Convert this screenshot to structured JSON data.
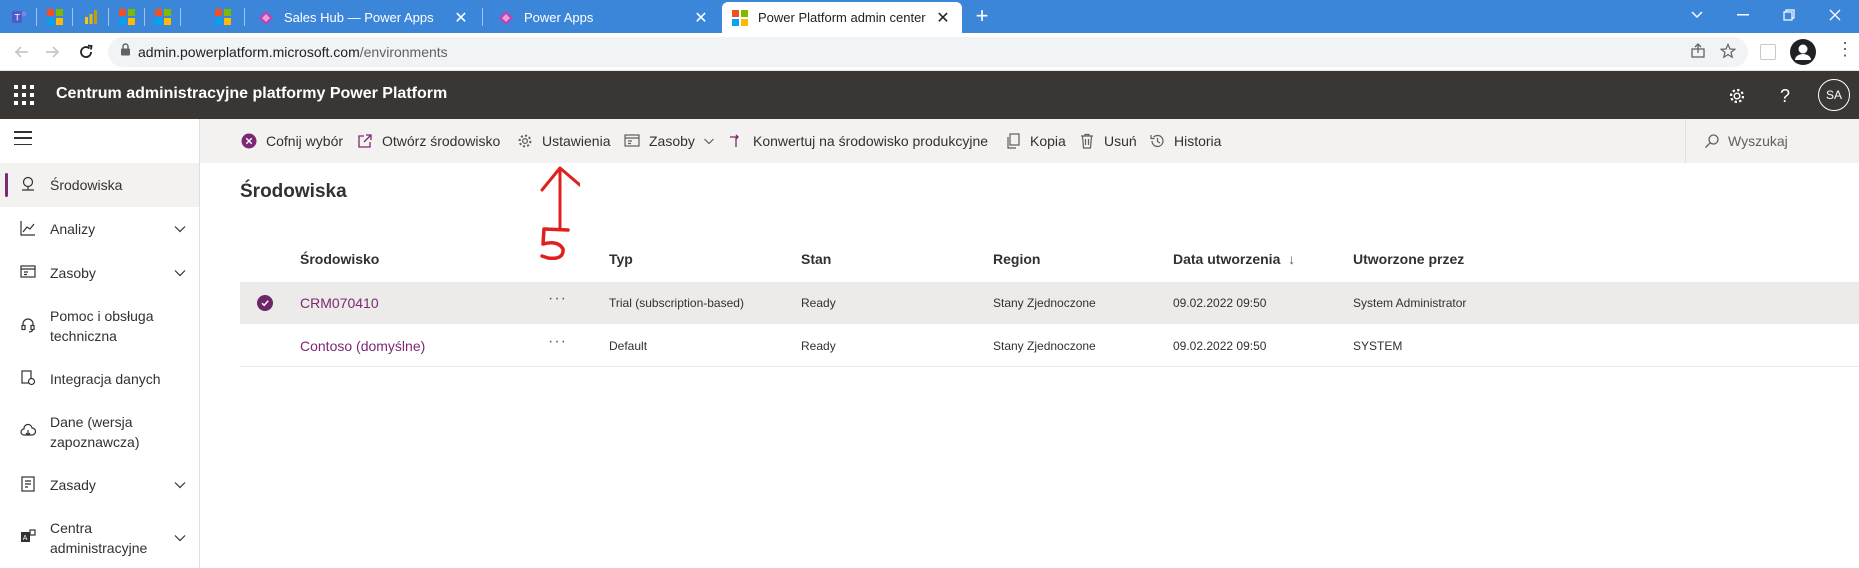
{
  "browser": {
    "tabs": [
      {
        "title": "Sales Hub — Power Apps"
      },
      {
        "title": "Power Apps"
      },
      {
        "title": "Power Platform admin center",
        "active": true
      }
    ],
    "new_tab_symbol": "+",
    "url_host": "admin.powerplatform.microsoft.com",
    "url_path": "/environments"
  },
  "header": {
    "title": "Centrum administracyjne platformy Power Platform",
    "avatar_initials": "SA"
  },
  "sidebar": {
    "items": [
      {
        "label": "Środowiska",
        "icon": "globe-network-icon",
        "active": true,
        "expandable": false
      },
      {
        "label": "Analizy",
        "icon": "chart-icon",
        "expandable": true
      },
      {
        "label": "Zasoby",
        "icon": "resources-icon",
        "expandable": true
      },
      {
        "label": "Pomoc i obsługa techniczna",
        "icon": "headset-icon",
        "expandable": false
      },
      {
        "label": "Integracja danych",
        "icon": "data-integration-icon",
        "expandable": false
      },
      {
        "label": "Dane (wersja zapoznawcza)",
        "icon": "cloud-data-icon",
        "expandable": false
      },
      {
        "label": "Zasady",
        "icon": "policy-icon",
        "expandable": true
      },
      {
        "label": "Centra administracyjne",
        "icon": "admin-centers-icon",
        "expandable": true
      }
    ]
  },
  "commandbar": {
    "deselect": "Cofnij wybór",
    "open": "Otwórz środowisko",
    "settings": "Ustawienia",
    "resources": "Zasoby",
    "convert": "Konwertuj na środowisko produkcyjne",
    "copy": "Kopia",
    "delete": "Usuń",
    "history": "Historia",
    "search": "Wyszukaj"
  },
  "main": {
    "title": "Środowiska",
    "columns": {
      "env": "Środowisko",
      "type": "Typ",
      "state": "Stan",
      "region": "Region",
      "created": "Data utworzenia",
      "sort_arrow": "↓",
      "created_by": "Utworzone przez"
    },
    "rows": [
      {
        "env": "CRM070410",
        "more": "···",
        "type": "Trial (subscription-based)",
        "state": "Ready",
        "region": "Stany Zjednoczone",
        "created": "09.02.2022 09:50",
        "created_by": "System Administrator",
        "selected": true
      },
      {
        "env": "Contoso (domyślne)",
        "more": "···",
        "type": "Default",
        "state": "Ready",
        "region": "Stany Zjednoczone",
        "created": "09.02.2022 09:50",
        "created_by": "SYSTEM",
        "selected": false
      }
    ]
  },
  "annotation": {
    "number": "5",
    "color": "#e0201c"
  },
  "colors": {
    "accent": "#7b2973",
    "header_bg": "#3a3633",
    "tabstrip": "#3c86d9"
  }
}
